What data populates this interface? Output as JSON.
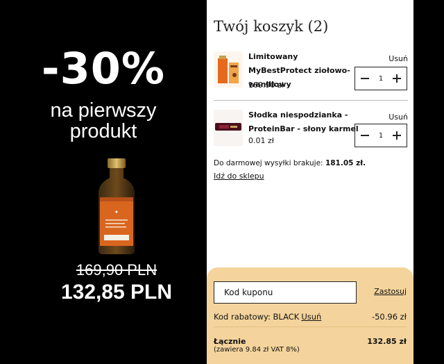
{
  "promo": {
    "discount": "-30%",
    "line1": "na pierwszy",
    "line2": "produkt",
    "old_price": "169,90 PLN",
    "new_price": "132,85 PLN",
    "product_icon": "supplement-bottle-icon"
  },
  "cart": {
    "title": "Twój koszyk (2)",
    "items": [
      {
        "name": "Limitowany MyBestProtect ziołowo-waniliowy",
        "price": "169.90 zł",
        "quantity": "1",
        "remove_label": "Usuń",
        "thumb_icon": "herbal-drink-bottle-icon"
      },
      {
        "name": "Słodka niespodzianka - ProteinBar - słony karmel",
        "price": "0.01 zł",
        "quantity": "1",
        "remove_label": "Usuń",
        "thumb_icon": "protein-bar-icon"
      }
    ],
    "shipping_text": "Do darmowej wysyłki brakuje:",
    "shipping_amount": "181.05 zł.",
    "shop_link": "Idź do sklepu"
  },
  "summary": {
    "coupon_placeholder": "Kod kuponu",
    "apply_label": "Zastosuj",
    "discount_label": "Kod rabatowy: BLACK",
    "discount_remove": "Usuń",
    "discount_value": "-50.96 zł",
    "total_label": "Łącznie",
    "total_vat": "(zawiera 9.84 zł VAT 8%)",
    "total_value": "132.85 zł",
    "background_color": "#f4d49c"
  }
}
